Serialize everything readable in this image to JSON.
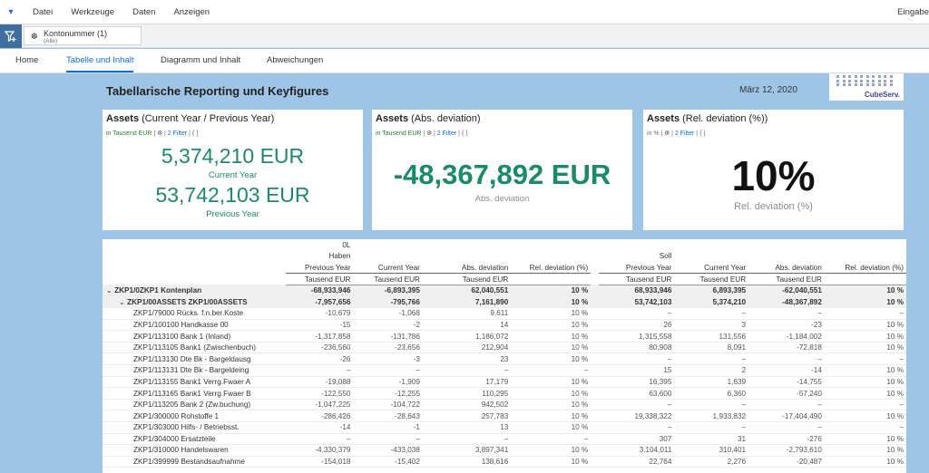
{
  "menu": {
    "items": [
      "Datei",
      "Werkzeuge",
      "Daten",
      "Anzeigen"
    ],
    "right_label": "Eingabe"
  },
  "filter": {
    "token_title": "Kontonummer (1)",
    "token_sub": "(Alle)"
  },
  "tabs": [
    "Home",
    "Tabelle und Inhalt",
    "Diagramm und Inhalt",
    "Abweichungen"
  ],
  "page": {
    "title": "Tabellarische Reporting und Keyfigures",
    "date": "März 12, 2020",
    "logo_text": "CubeServ."
  },
  "cards": [
    {
      "title_bold": "Assets",
      "title_rest": "(Current Year / Previous Year)",
      "unit": "in Tausend EUR",
      "filter_link": "2 Filter",
      "braces": "{ }",
      "value1": "5,374,210 EUR",
      "label1": "Current Year",
      "value2": "53,742,103 EUR",
      "label2": "Previous Year"
    },
    {
      "title_bold": "Assets",
      "title_rest": "(Abs. deviation)",
      "unit": "in Tausend EUR",
      "filter_link": "2 Filter",
      "braces": "{ }",
      "value1": "-48,367,892 EUR",
      "label1": "Abs. deviation"
    },
    {
      "title_bold": "Assets",
      "title_rest": "(Rel. deviation (%))",
      "unit": "in %",
      "filter_link": "2 Filter",
      "braces": "{ }",
      "value1": "10%",
      "label1": "Rel. deviation (%)"
    }
  ],
  "table": {
    "group_header_left": [
      "0L",
      "Haben"
    ],
    "group_header_right": "Soll",
    "columns": [
      "Previous Year",
      "Current Year",
      "Abs. deviation",
      "Rel. deviation (%)"
    ],
    "units": [
      "Tausend EUR",
      "Tausend EUR",
      "Tausend EUR",
      ""
    ],
    "rows": [
      {
        "level": 1,
        "bold": true,
        "name": "ZKP1/0ZKP1 Kontenplan",
        "v": [
          "-68,933,946",
          "-6,893,395",
          "62,040,551",
          "10 %",
          "68,933,946",
          "6,893,395",
          "-62,040,551",
          "10 %"
        ]
      },
      {
        "level": 2,
        "bold": true,
        "name": "ZKP1/00ASSETS ZKP1/00ASSETS",
        "v": [
          "-7,957,656",
          "-795,766",
          "7,161,890",
          "10 %",
          "53,742,103",
          "5,374,210",
          "-48,367,892",
          "10 %"
        ]
      },
      {
        "level": 3,
        "name": "ZKP1/79000 Rücks. f.n.ber.Koste",
        "v": [
          "-10,679",
          "-1,068",
          "9,611",
          "10 %",
          "–",
          "–",
          "–",
          "–"
        ]
      },
      {
        "level": 3,
        "name": "ZKP1/100100 Handkasse 00",
        "v": [
          "-15",
          "-2",
          "14",
          "10 %",
          "26",
          "3",
          "-23",
          "10 %"
        ]
      },
      {
        "level": 3,
        "name": "ZKP1/113100 Bank 1 (Inland)",
        "v": [
          "-1,317,858",
          "-131,786",
          "1,186,072",
          "10 %",
          "1,315,558",
          "131,556",
          "-1,184,002",
          "10 %"
        ]
      },
      {
        "level": 3,
        "name": "ZKP1/113105 Bank1 (Zwischenbuch)",
        "v": [
          "-236,560",
          "-23,656",
          "212,904",
          "10 %",
          "80,908",
          "8,091",
          "-72,818",
          "10 %"
        ]
      },
      {
        "level": 3,
        "name": "ZKP1/113130 Dte Bk - Bargeldausg",
        "v": [
          "-26",
          "-3",
          "23",
          "10 %",
          "–",
          "–",
          "–",
          "–"
        ]
      },
      {
        "level": 3,
        "name": "ZKP1/113131 Dte Bk - Bargeldeing",
        "v": [
          "–",
          "–",
          "–",
          "–",
          "15",
          "2",
          "-14",
          "10 %"
        ]
      },
      {
        "level": 3,
        "name": "ZKP1/113155 Bank1 Verrg.Fwaer A",
        "v": [
          "-19,088",
          "-1,909",
          "17,179",
          "10 %",
          "16,395",
          "1,639",
          "-14,755",
          "10 %"
        ]
      },
      {
        "level": 3,
        "name": "ZKP1/113165 Bank1 Verrg.Fwaer B",
        "v": [
          "-122,550",
          "-12,255",
          "110,295",
          "10 %",
          "63,600",
          "6,360",
          "-57,240",
          "10 %"
        ]
      },
      {
        "level": 3,
        "name": "ZKP1/113205 Bank 2 (Zw.buchung)",
        "v": [
          "-1,047,225",
          "-104,722",
          "942,502",
          "10 %",
          "–",
          "–",
          "–",
          "–"
        ]
      },
      {
        "level": 3,
        "name": "ZKP1/300000 Rohstoffe 1",
        "v": [
          "-286,426",
          "-28,643",
          "257,783",
          "10 %",
          "19,338,322",
          "1,933,832",
          "-17,404,490",
          "10 %"
        ]
      },
      {
        "level": 3,
        "name": "ZKP1/303000 Hilfs- / Betriebsst.",
        "v": [
          "-14",
          "-1",
          "13",
          "10 %",
          "–",
          "–",
          "–",
          "–"
        ]
      },
      {
        "level": 3,
        "name": "ZKP1/304000 Ersatzteile",
        "v": [
          "–",
          "–",
          "–",
          "–",
          "307",
          "31",
          "-276",
          "10 %"
        ]
      },
      {
        "level": 3,
        "name": "ZKP1/310000 Handelswaren",
        "v": [
          "-4,330,379",
          "-433,038",
          "3,897,341",
          "10 %",
          "3,104,011",
          "310,401",
          "-2,793,610",
          "10 %"
        ]
      },
      {
        "level": 3,
        "name": "ZKP1/399999 Bestandsaufnahme",
        "v": [
          "-154,018",
          "-15,402",
          "138,616",
          "10 %",
          "22,764",
          "2,276",
          "-20,487",
          "10 %"
        ]
      }
    ]
  },
  "colors": {
    "accent": "#0a6ed1",
    "kpi_green": "#1b8a6b",
    "background": "#9ec4e6"
  }
}
